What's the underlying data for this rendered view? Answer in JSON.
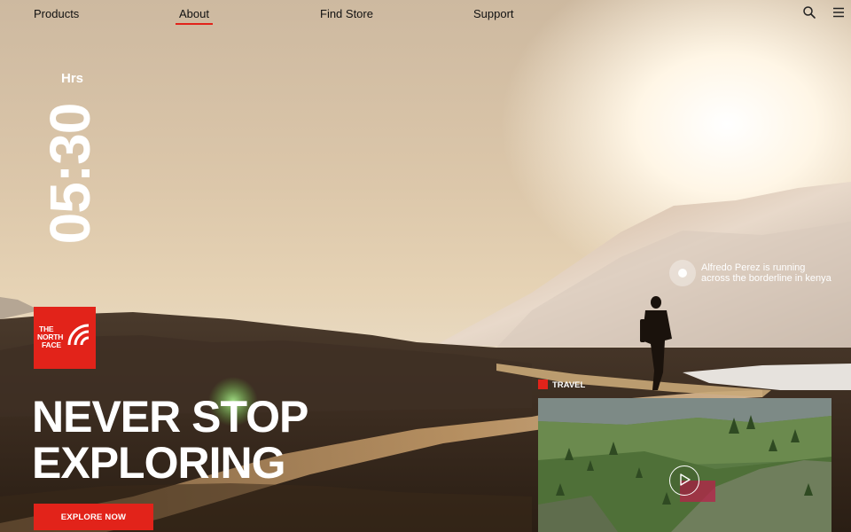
{
  "nav": {
    "items": [
      {
        "label": "Products",
        "active": false
      },
      {
        "label": "About",
        "active": true
      },
      {
        "label": "Find Store",
        "active": false
      },
      {
        "label": "Support",
        "active": false
      }
    ],
    "icons": [
      "search-icon",
      "menu-icon"
    ]
  },
  "clock": {
    "time": "05:30",
    "unit": "Hrs"
  },
  "brand": {
    "logo_lines": [
      "THE",
      "NORTH",
      "FACE"
    ],
    "color": "#e2231a"
  },
  "hero": {
    "headline_lines": [
      "NEVER STOP",
      "EXPLORING"
    ],
    "cta_label": "EXPLORE NOW"
  },
  "runner": {
    "caption_lines": [
      "Alfredo Perez is running",
      "across the borderline in kenya"
    ]
  },
  "video_card": {
    "tag": "TRAVEL",
    "play_icon": "play-icon"
  },
  "colors": {
    "accent": "#e2231a",
    "text_light": "#ffffff",
    "text_dark": "#111111"
  }
}
